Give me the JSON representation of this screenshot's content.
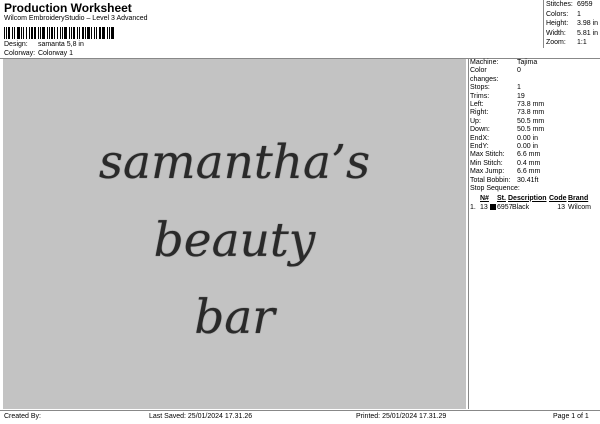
{
  "header": {
    "title": "Production Worksheet",
    "subtitle": "Wilcom EmbroideryStudio – Level 3 Advanced",
    "design_label": "Design:",
    "design_value": "samanta 5,8 in",
    "colorway_label": "Colorway:",
    "colorway_value": "Colorway 1"
  },
  "summary": [
    {
      "label": "Stitches:",
      "value": "6959"
    },
    {
      "label": "Colors:",
      "value": "1"
    },
    {
      "label": "Height:",
      "value": "3.98 in"
    },
    {
      "label": "Width:",
      "value": "5.81 in"
    },
    {
      "label": "Zoom:",
      "value": "1:1"
    }
  ],
  "design": {
    "lines": [
      "samantha’s",
      "beauty",
      "bar"
    ],
    "thread_color": "#2a2a2a",
    "background_color": "#c3c3c3"
  },
  "machine_info": [
    {
      "label": "Machine:",
      "value": "Tajima"
    },
    {
      "label": "Color changes:",
      "value": "0"
    },
    {
      "label": "Stops:",
      "value": "1"
    },
    {
      "label": "Trims:",
      "value": "19"
    },
    {
      "label": "Left:",
      "value": "73.8 mm"
    },
    {
      "label": "Right:",
      "value": "73.8 mm"
    },
    {
      "label": "Up:",
      "value": "50.5 mm"
    },
    {
      "label": "Down:",
      "value": "50.5 mm"
    },
    {
      "label": "EndX:",
      "value": "0.00 in"
    },
    {
      "label": "EndY:",
      "value": "0.00 in"
    },
    {
      "label": "Max Stitch:",
      "value": "6.6 mm"
    },
    {
      "label": "Min Stitch:",
      "value": "0.4 mm"
    },
    {
      "label": "Max Jump:",
      "value": "6.6 mm"
    },
    {
      "label": "Total Bobbin:",
      "value": "30.41ft"
    }
  ],
  "stop_sequence": {
    "title": "Stop Sequence:",
    "columns": [
      "N#",
      "St.",
      "Description",
      "Code",
      "Brand"
    ],
    "rows": [
      {
        "index": "1.",
        "n": "13",
        "swatch": "#000000",
        "st": "6957",
        "description": "Black",
        "code": "13",
        "brand": "Wilcom"
      }
    ]
  },
  "footer": {
    "created": "Created By:",
    "last_saved": "Last Saved: 25/01/2024 17.31.26",
    "printed": "Printed: 25/01/2024 17.31.29",
    "page": "Page 1 of 1"
  }
}
